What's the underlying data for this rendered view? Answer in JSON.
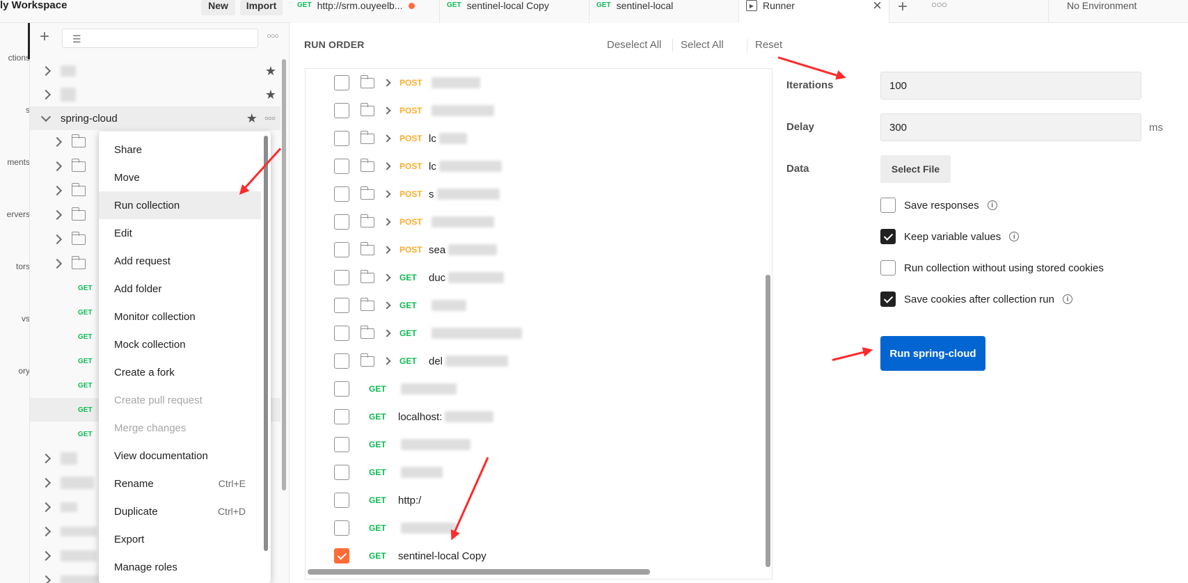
{
  "header": {
    "workspace_title": "ly Workspace",
    "new_label": "New",
    "import_label": "Import",
    "no_environment": "No Environment"
  },
  "tabs": [
    {
      "method": "GET",
      "label": "http://srm.ouyeelb...",
      "unsaved": true
    },
    {
      "method": "GET",
      "label": "sentinel-local Copy"
    },
    {
      "method": "GET",
      "label": "sentinel-local"
    },
    {
      "label": "Runner",
      "active": true
    }
  ],
  "rail": [
    "ctions",
    "s",
    "ments",
    "ervers",
    "tors",
    "vs",
    "ory"
  ],
  "sidebar": {
    "collection_name": "spring-cloud",
    "request_method": "GET"
  },
  "context_menu": [
    {
      "label": "Share"
    },
    {
      "label": "Move"
    },
    {
      "label": "Run collection",
      "highlighted": true
    },
    {
      "label": "Edit"
    },
    {
      "label": "Add request"
    },
    {
      "label": "Add folder"
    },
    {
      "label": "Monitor collection"
    },
    {
      "label": "Mock collection"
    },
    {
      "label": "Create a fork"
    },
    {
      "label": "Create pull request",
      "disabled": true
    },
    {
      "label": "Merge changes",
      "disabled": true
    },
    {
      "label": "View documentation"
    },
    {
      "label": "Rename",
      "shortcut": "Ctrl+E"
    },
    {
      "label": "Duplicate",
      "shortcut": "Ctrl+D"
    },
    {
      "label": "Export"
    },
    {
      "label": "Manage roles"
    }
  ],
  "runner": {
    "run_order_label": "RUN ORDER",
    "deselect_all": "Deselect All",
    "select_all": "Select All",
    "reset": "Reset",
    "items": [
      {
        "method": "POST",
        "folder": true,
        "text": "",
        "checked": false
      },
      {
        "method": "POST",
        "folder": true,
        "text": "",
        "checked": false
      },
      {
        "method": "POST",
        "folder": true,
        "text": "lc",
        "checked": false
      },
      {
        "method": "POST",
        "folder": true,
        "text": "lc",
        "checked": false
      },
      {
        "method": "POST",
        "folder": true,
        "text": "s",
        "checked": false
      },
      {
        "method": "POST",
        "folder": true,
        "text": "",
        "checked": false
      },
      {
        "method": "POST",
        "folder": true,
        "text": "sea",
        "checked": false
      },
      {
        "method": "GET",
        "folder": true,
        "text": "duc",
        "checked": false
      },
      {
        "method": "GET",
        "folder": true,
        "text": "",
        "checked": false
      },
      {
        "method": "GET",
        "folder": true,
        "text": "",
        "checked": false
      },
      {
        "method": "GET",
        "folder": true,
        "text": "del",
        "checked": false
      },
      {
        "method": "GET",
        "folder": false,
        "text": "",
        "checked": false
      },
      {
        "method": "GET",
        "folder": false,
        "text": "localhost:",
        "checked": false
      },
      {
        "method": "GET",
        "folder": false,
        "text": "",
        "checked": false
      },
      {
        "method": "GET",
        "folder": false,
        "text": "",
        "checked": false
      },
      {
        "method": "GET",
        "folder": false,
        "text": "http:/",
        "checked": false
      },
      {
        "method": "GET",
        "folder": false,
        "text": "",
        "checked": false
      },
      {
        "method": "GET",
        "folder": false,
        "text": "sentinel-local Copy",
        "checked": true
      }
    ]
  },
  "settings": {
    "iterations_label": "Iterations",
    "iterations_value": "100",
    "delay_label": "Delay",
    "delay_value": "300",
    "delay_unit": "ms",
    "data_label": "Data",
    "select_file": "Select File",
    "options": [
      {
        "label": "Save responses",
        "checked": false,
        "info": true
      },
      {
        "label": "Keep variable values",
        "checked": true,
        "info": true
      },
      {
        "label": "Run collection without using stored cookies",
        "checked": false,
        "info": false
      },
      {
        "label": "Save cookies after collection run",
        "checked": true,
        "info": true
      }
    ],
    "run_button": "Run spring-cloud"
  },
  "colors": {
    "accent_orange": "#ff6c37",
    "run_blue": "#0265d2",
    "get_green": "#0cbb52",
    "post_orange": "#ffad2b",
    "annotation_red": "#ff2a2a"
  }
}
